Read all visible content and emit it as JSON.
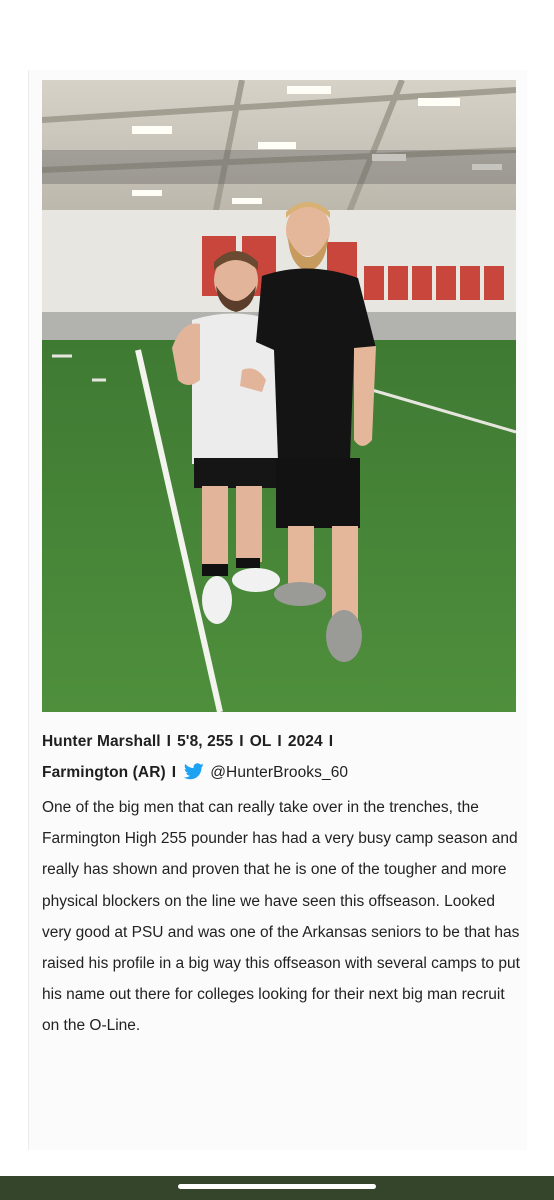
{
  "photo": {
    "subject": "two-people-on-indoor-football-field",
    "colors": {
      "turf": "#4a8a3a",
      "banners": "#c8463c",
      "ceiling": "#c9c4b8"
    }
  },
  "caption": {
    "name": "Hunter Marshall",
    "sep1": "I",
    "size": "5'8, 255",
    "sep2": "I",
    "position": "OL",
    "sep3": "I",
    "class_year": "2024",
    "sep4": "I",
    "hometown": "Farmington (AR)",
    "sep5": "I",
    "twitter_icon": "twitter-bird-icon",
    "twitter_handle": "@HunterBrooks_60",
    "body": "One of the big men that can  really take over in the trenches, the Farmington High 255 pounder has had a very busy camp season and really has shown and proven that he is one of the tougher and more physical blockers on the line we have seen this offseason.  Looked very good at PSU and was one of the Arkansas seniors to be that has raised his profile in a big way this offseason with several camps to put his name out there for colleges looking for their next big man recruit on the O-Line."
  },
  "colors": {
    "twitter_blue": "#1da1f2",
    "bottom_bar": "#34452c"
  }
}
